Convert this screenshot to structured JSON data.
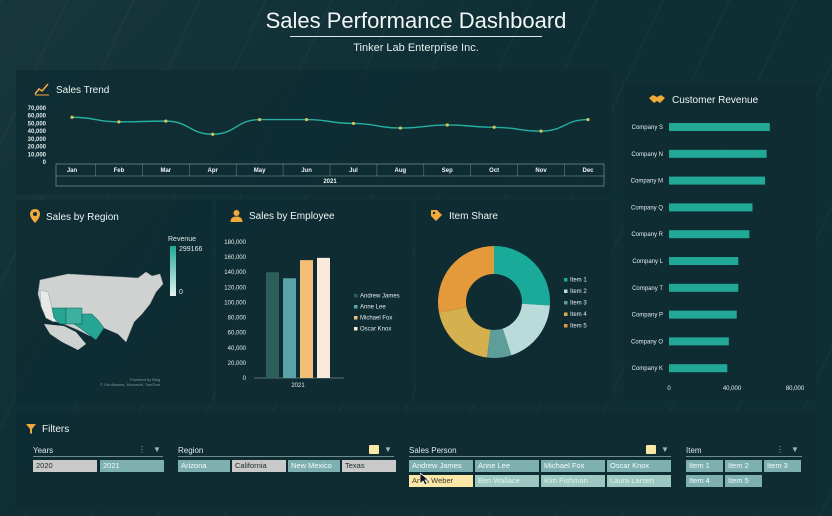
{
  "header": {
    "title": "Sales Performance Dashboard",
    "subtitle": "Tinker Lab Enterprise Inc."
  },
  "colors": {
    "accent_teal": "#21a896",
    "accent_orange": "#f2a93b",
    "panel": "#0e2c32",
    "donut_item1": "#1aaa99",
    "donut_item2": "#b9dcdb",
    "donut_item3": "#5e9e9a",
    "donut_item4": "#d4b04f",
    "donut_item5": "#e49a3a"
  },
  "panels": {
    "trend_title": "Sales Trend",
    "region_title": "Sales by Region",
    "employee_title": "Sales by Employee",
    "item_title": "Item Share",
    "customer_title": "Customer Revenue",
    "filters_title": "Filters"
  },
  "region_legend": {
    "label": "Revenue",
    "max": "299166",
    "min": "0"
  },
  "map_credit_1": "Powered by Bing",
  "map_credit_2": "© GeoNames, Microsoft, TomTom",
  "chart_data": [
    {
      "type": "line",
      "title": "Sales Trend",
      "categories": [
        "Jan",
        "Feb",
        "Mar",
        "Apr",
        "May",
        "Jun",
        "Jul",
        "Aug",
        "Sep",
        "Oct",
        "Nov",
        "Dec"
      ],
      "values": [
        58000,
        52000,
        53000,
        36000,
        55000,
        55000,
        50000,
        44000,
        48000,
        45000,
        40000,
        55000
      ],
      "xlabel": "2021",
      "yticks": [
        "70,000",
        "60,000",
        "50,000",
        "40,000",
        "30,000",
        "20,000",
        "10,000",
        "0"
      ],
      "ylim": [
        0,
        70000
      ]
    },
    {
      "type": "bar",
      "title": "Sales by Employee",
      "categories": [
        "2021"
      ],
      "series": [
        {
          "name": "Andrew James",
          "value": 140000,
          "color": "#2e5e5c"
        },
        {
          "name": "Anne Lee",
          "value": 132000,
          "color": "#5aa3a8"
        },
        {
          "name": "Michael Fox",
          "value": 156000,
          "color": "#f3bf78"
        },
        {
          "name": "Oscar Knox",
          "value": 159000,
          "color": "#fbeadb"
        }
      ],
      "yticks": [
        "180,000",
        "160,000",
        "140,000",
        "120,000",
        "100,000",
        "80,000",
        "60,000",
        "40,000",
        "20,000",
        "0"
      ],
      "ylim": [
        0,
        180000
      ]
    },
    {
      "type": "pie",
      "title": "Item Share",
      "labels": [
        "Item 1",
        "Item 2",
        "Item 3",
        "Item 4",
        "Item 5"
      ],
      "values": [
        26,
        19,
        7,
        20,
        28
      ],
      "colors": [
        "#1aaa99",
        "#b9dcdb",
        "#5e9e9a",
        "#d4b04f",
        "#e49a3a"
      ]
    },
    {
      "type": "bar",
      "title": "Customer Revenue",
      "categories": [
        "Company S",
        "Company N",
        "Company M",
        "Company Q",
        "Company R",
        "Company L",
        "Company T",
        "Company P",
        "Company O",
        "Company K"
      ],
      "values": [
        64000,
        62000,
        61000,
        53000,
        51000,
        44000,
        44000,
        43000,
        38000,
        37000
      ],
      "xticks": [
        "0",
        "40,000",
        "80,000"
      ],
      "xlim": [
        0,
        80000
      ]
    }
  ],
  "filters": {
    "years": {
      "label": "Years",
      "items": [
        "2020",
        "2021"
      ]
    },
    "region": {
      "label": "Region",
      "items": [
        "Arizona",
        "California",
        "New Mexico",
        "Texas"
      ]
    },
    "sales_person": {
      "label": "Sales Person",
      "items": [
        "Andrew James",
        "Anne Lee",
        "Michael Fox",
        "Oscar Knox",
        "Anita Weber",
        "Ben Wallace",
        "Kim Fishman",
        "Laura Larsen"
      ]
    },
    "item": {
      "label": "Item",
      "items": [
        "Item 1",
        "Item 2",
        "Item 3",
        "Item 4",
        "Item 5"
      ]
    }
  }
}
